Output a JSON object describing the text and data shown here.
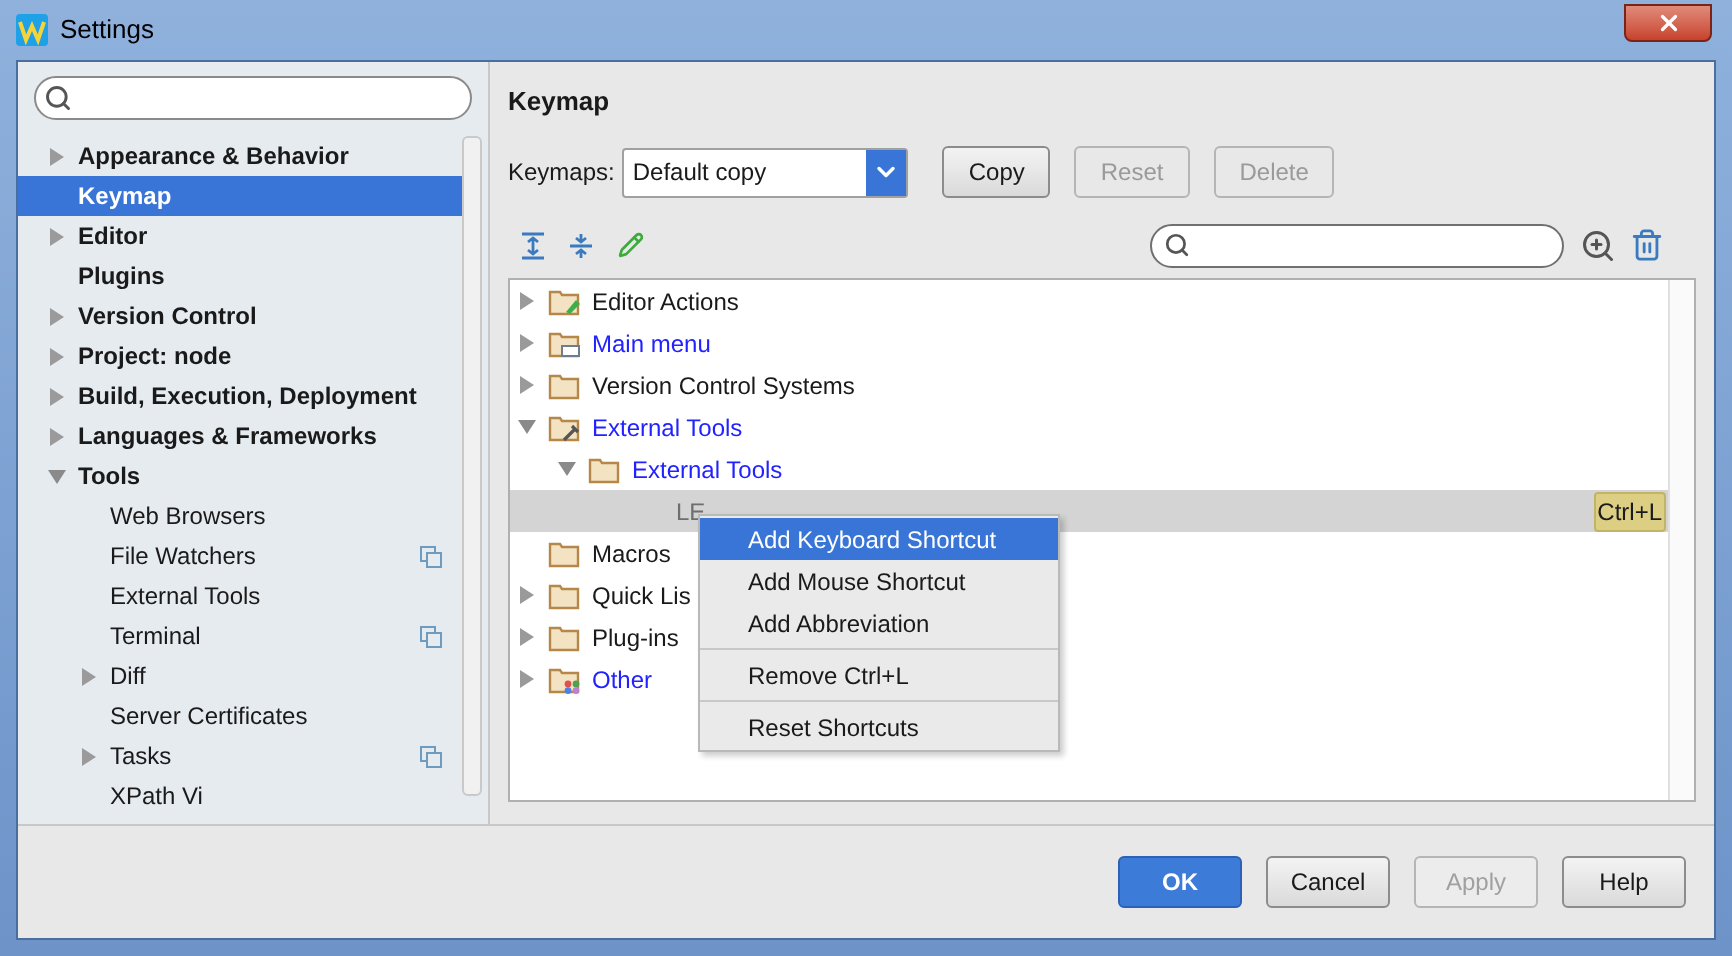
{
  "window": {
    "title": "Settings"
  },
  "sidebar": {
    "items": [
      {
        "label": "Appearance & Behavior",
        "expanded": false,
        "selected": false
      },
      {
        "label": "Keymap",
        "selected": true
      },
      {
        "label": "Editor",
        "expanded": false,
        "selected": false
      },
      {
        "label": "Plugins",
        "selected": false
      },
      {
        "label": "Version Control",
        "expanded": false,
        "selected": false
      },
      {
        "label": "Project: node",
        "expanded": false,
        "selected": false
      },
      {
        "label": "Build, Execution, Deployment",
        "expanded": false,
        "selected": false
      },
      {
        "label": "Languages & Frameworks",
        "expanded": false,
        "selected": false
      },
      {
        "label": "Tools",
        "expanded": true,
        "selected": false,
        "children": [
          {
            "label": "Web Browsers",
            "project_scoped": false,
            "selected": false
          },
          {
            "label": "File Watchers",
            "project_scoped": true,
            "selected": false
          },
          {
            "label": "External Tools",
            "project_scoped": false,
            "selected": false
          },
          {
            "label": "Terminal",
            "project_scoped": true,
            "selected": false
          },
          {
            "label": "Diff",
            "expanded": false,
            "project_scoped": false,
            "selected": false
          },
          {
            "label": "Server Certificates",
            "project_scoped": false,
            "selected": false
          },
          {
            "label": "Tasks",
            "expanded": false,
            "project_scoped": true,
            "selected": false
          },
          {
            "label": "XPath Vi",
            "project_scoped": false,
            "selected": false
          }
        ]
      }
    ]
  },
  "panel": {
    "title": "Keymap",
    "keymaps_label": "Keymaps:",
    "keymap_value": "Default copy",
    "buttons": [
      {
        "label": "Copy",
        "disabled": false
      },
      {
        "label": "Reset",
        "disabled": true
      },
      {
        "label": "Delete",
        "disabled": true
      }
    ]
  },
  "tree": [
    {
      "label": "Editor Actions",
      "kind": "edit",
      "expanded": false,
      "modified": false,
      "selected": false
    },
    {
      "label": "Main menu",
      "kind": "menu",
      "expanded": false,
      "modified": true,
      "selected": false
    },
    {
      "label": "Version Control Systems",
      "kind": "folder",
      "expanded": false,
      "modified": false,
      "selected": false
    },
    {
      "label": "External Tools",
      "kind": "tools",
      "expanded": true,
      "modified": true,
      "selected": false,
      "children": [
        {
          "label": "External Tools",
          "kind": "folder",
          "expanded": true,
          "modified": true,
          "selected": false,
          "children": [
            {
              "label": "LE",
              "kind": "action",
              "selected": true,
              "shortcut": "Ctrl+L"
            }
          ]
        }
      ]
    },
    {
      "label": "Macros",
      "kind": "folder",
      "modified": false,
      "selected": false
    },
    {
      "label": "Quick Lis",
      "kind": "folder",
      "expanded": false,
      "modified": false,
      "selected": false
    },
    {
      "label": "Plug-ins",
      "kind": "folder",
      "expanded": false,
      "modified": false,
      "selected": false
    },
    {
      "label": "Other",
      "kind": "other",
      "expanded": false,
      "modified": true,
      "selected": false
    }
  ],
  "context_menu": {
    "groups": [
      [
        {
          "label": "Add Keyboard Shortcut",
          "selected": true
        },
        {
          "label": "Add Mouse Shortcut",
          "selected": false
        },
        {
          "label": "Add Abbreviation",
          "selected": false
        }
      ],
      [
        {
          "label": "Remove Ctrl+L",
          "selected": false
        }
      ],
      [
        {
          "label": "Reset Shortcuts",
          "selected": false
        }
      ]
    ]
  },
  "footer": {
    "buttons": [
      {
        "label": "OK",
        "kind": "primary",
        "disabled": false
      },
      {
        "label": "Cancel",
        "kind": "normal",
        "disabled": false
      },
      {
        "label": "Apply",
        "kind": "normal",
        "disabled": true
      },
      {
        "label": "Help",
        "kind": "normal",
        "disabled": false
      }
    ]
  }
}
